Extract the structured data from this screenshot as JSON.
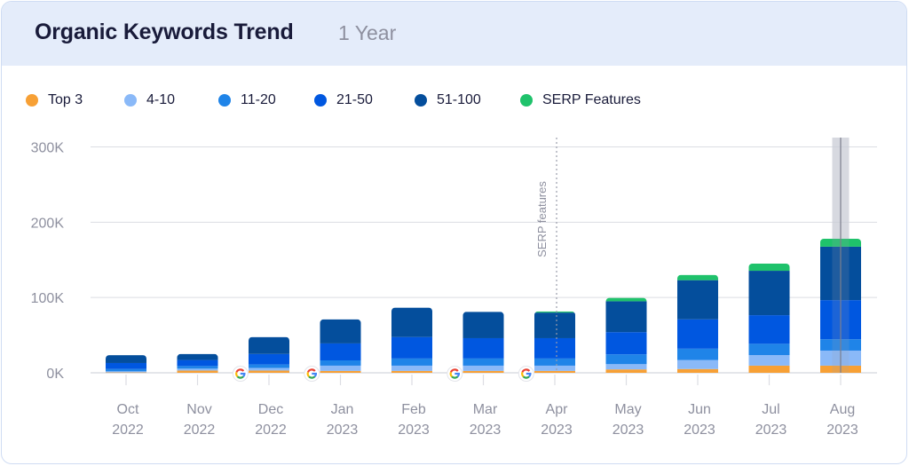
{
  "header": {
    "title": "Organic Keywords Trend",
    "period": "1 Year"
  },
  "legend": [
    {
      "key": "top3",
      "label": "Top 3",
      "color": "#f7a035"
    },
    {
      "key": "r4_10",
      "label": "4-10",
      "color": "#8ab9f8"
    },
    {
      "key": "r11_20",
      "label": "11-20",
      "color": "#1f84e8"
    },
    {
      "key": "r21_50",
      "label": "21-50",
      "color": "#0057e0"
    },
    {
      "key": "r51_100",
      "label": "51-100",
      "color": "#044e9c"
    },
    {
      "key": "serp",
      "label": "SERP Features",
      "color": "#1fc26b"
    }
  ],
  "chart_data": {
    "type": "bar",
    "stacked": true,
    "title": "Organic Keywords Trend",
    "subtitle": "1 Year",
    "xlabel": "",
    "ylabel": "",
    "ylim": [
      0,
      300000
    ],
    "yticks": [
      0,
      100000,
      200000,
      300000
    ],
    "ytick_labels": [
      "0K",
      "100K",
      "200K",
      "300K"
    ],
    "grid": true,
    "legend_position": "top-left",
    "categories": [
      "Oct 2022",
      "Nov 2022",
      "Dec 2022",
      "Jan 2023",
      "Feb 2023",
      "Mar 2023",
      "Apr 2023",
      "May 2023",
      "Jun 2023",
      "Jul 2023",
      "Aug 2023"
    ],
    "category_lines": [
      [
        "Oct",
        "2022"
      ],
      [
        "Nov",
        "2022"
      ],
      [
        "Dec",
        "2022"
      ],
      [
        "Jan",
        "2023"
      ],
      [
        "Feb",
        "2023"
      ],
      [
        "Mar",
        "2023"
      ],
      [
        "Apr",
        "2023"
      ],
      [
        "May",
        "2023"
      ],
      [
        "Jun",
        "2023"
      ],
      [
        "Jul",
        "2023"
      ],
      [
        "Aug",
        "2023"
      ]
    ],
    "series": [
      {
        "name": "Top 3",
        "color": "#f7a035",
        "values": [
          500,
          3000,
          3000,
          2500,
          2500,
          2500,
          2500,
          4500,
          5000,
          9500,
          9500
        ]
      },
      {
        "name": "4-10",
        "color": "#8ab9f8",
        "values": [
          1500,
          2500,
          3500,
          7000,
          7000,
          7000,
          7000,
          7000,
          12000,
          14000,
          20000
        ]
      },
      {
        "name": "11-20",
        "color": "#1f84e8",
        "values": [
          3000,
          3500,
          4500,
          7000,
          9500,
          9500,
          9500,
          13000,
          15000,
          15000,
          15000
        ]
      },
      {
        "name": "21-50",
        "color": "#0057e0",
        "values": [
          8000,
          8000,
          14000,
          22500,
          28500,
          27000,
          27000,
          29500,
          39000,
          38000,
          52000
        ]
      },
      {
        "name": "51-100",
        "color": "#044e9c",
        "values": [
          10500,
          8000,
          22500,
          32000,
          39000,
          35000,
          34000,
          41000,
          52000,
          59000,
          71000
        ]
      },
      {
        "name": "SERP Features",
        "color": "#1fc26b",
        "values": [
          0,
          0,
          0,
          0,
          0,
          0,
          1500,
          4500,
          7000,
          9500,
          10500
        ]
      }
    ],
    "annotations": [
      {
        "type": "vertical-dotted-line",
        "at_category": "Apr 2023",
        "text": "SERP features"
      },
      {
        "type": "google-update-marker",
        "between": [
          "Nov 2022",
          "Dec 2022"
        ]
      },
      {
        "type": "google-update-marker",
        "between": [
          "Dec 2022",
          "Jan 2023"
        ]
      },
      {
        "type": "google-update-marker",
        "between": [
          "Feb 2023",
          "Mar 2023"
        ]
      },
      {
        "type": "google-update-marker",
        "between": [
          "Mar 2023",
          "Apr 2023"
        ]
      }
    ],
    "highlighted_category": "Aug 2023"
  }
}
